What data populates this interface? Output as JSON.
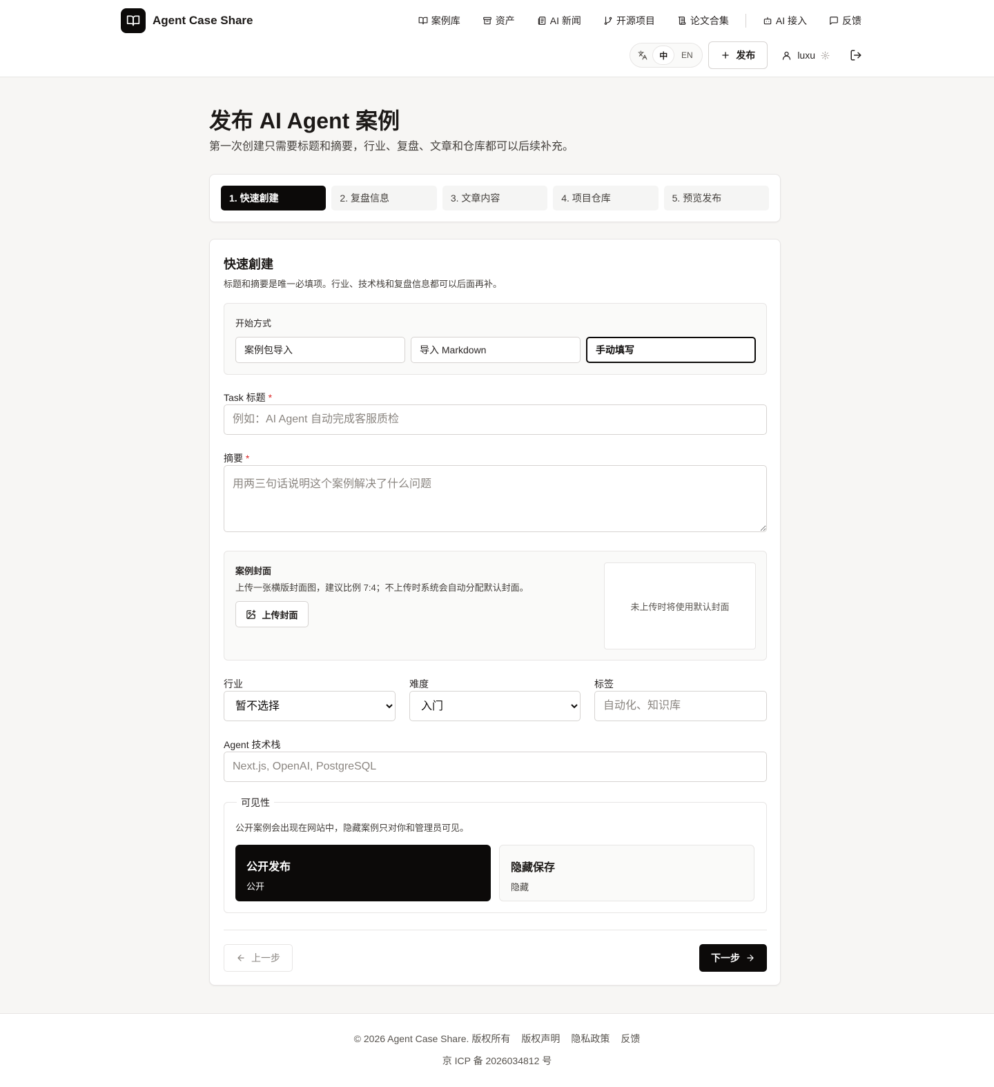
{
  "app": {
    "name": "Agent Case Share"
  },
  "nav": {
    "items": [
      {
        "label": "案例库",
        "icon": "book-open-icon"
      },
      {
        "label": "资产",
        "icon": "archive-icon"
      },
      {
        "label": "AI 新闻",
        "icon": "newspaper-icon"
      },
      {
        "label": "开源项目",
        "icon": "git-branch-icon"
      },
      {
        "label": "论文合集",
        "icon": "scroll-icon"
      },
      {
        "label": "AI 接入",
        "icon": "bot-icon"
      },
      {
        "label": "反馈",
        "icon": "message-square-icon"
      }
    ]
  },
  "toolbar": {
    "lang_zh": "中",
    "lang_en": "EN",
    "publish_label": "发布",
    "username": "luxu"
  },
  "page": {
    "title": "发布 AI Agent 案例",
    "subtitle": "第一次创建只需要标题和摘要，行业、复盘、文章和仓库都可以后续补充。"
  },
  "steps": [
    {
      "label": "1. 快速創建",
      "active": true
    },
    {
      "label": "2. 复盘信息",
      "active": false
    },
    {
      "label": "3. 文章内容",
      "active": false
    },
    {
      "label": "4. 项目仓库",
      "active": false
    },
    {
      "label": "5. 预览发布",
      "active": false
    }
  ],
  "form": {
    "title": "快速創建",
    "desc": "标题和摘要是唯一必填项。行业、技术栈和复盘信息都可以后面再补。",
    "start": {
      "label": "开始方式",
      "options": [
        "案例包导入",
        "导入 Markdown",
        "手动填写"
      ],
      "selected": "手动填写"
    },
    "task_title": {
      "label": "Task 标题",
      "required_mark": "*",
      "placeholder": "例如：AI Agent 自动完成客服质检",
      "value": ""
    },
    "summary": {
      "label": "摘要",
      "required_mark": "*",
      "placeholder": "用两三句话说明这个案例解决了什么问题",
      "value": ""
    },
    "cover": {
      "label": "案例封面",
      "desc": "上传一张横版封面图，建议比例 7:4；不上传时系统会自动分配默认封面。",
      "button": "上传封面",
      "preview_text": "未上传时将使用默认封面"
    },
    "industry": {
      "label": "行业",
      "value": "暂不选择"
    },
    "difficulty": {
      "label": "难度",
      "value": "入门"
    },
    "tags": {
      "label": "标签",
      "placeholder": "自动化、知识库",
      "value": ""
    },
    "tech_stack": {
      "label": "Agent 技术栈",
      "placeholder": "Next.js, OpenAI, PostgreSQL",
      "value": ""
    },
    "visibility": {
      "legend": "可见性",
      "desc": "公开案例会出现在网站中，隐藏案例只对你和管理员可见。",
      "options": [
        {
          "title": "公开发布",
          "sub": "公开",
          "selected": true
        },
        {
          "title": "隐藏保存",
          "sub": "隐藏",
          "selected": false
        }
      ]
    },
    "prev_label": "上一步",
    "next_label": "下一步"
  },
  "footer": {
    "links": [
      "© 2026 Agent Case Share. 版权所有",
      "版权声明",
      "隐私政策",
      "反馈"
    ],
    "icp": "京 ICP 备 2026034812 号"
  },
  "colors": {
    "primary": "#0c0a09",
    "required": "#dc2626",
    "background": "#f7f6f4"
  }
}
